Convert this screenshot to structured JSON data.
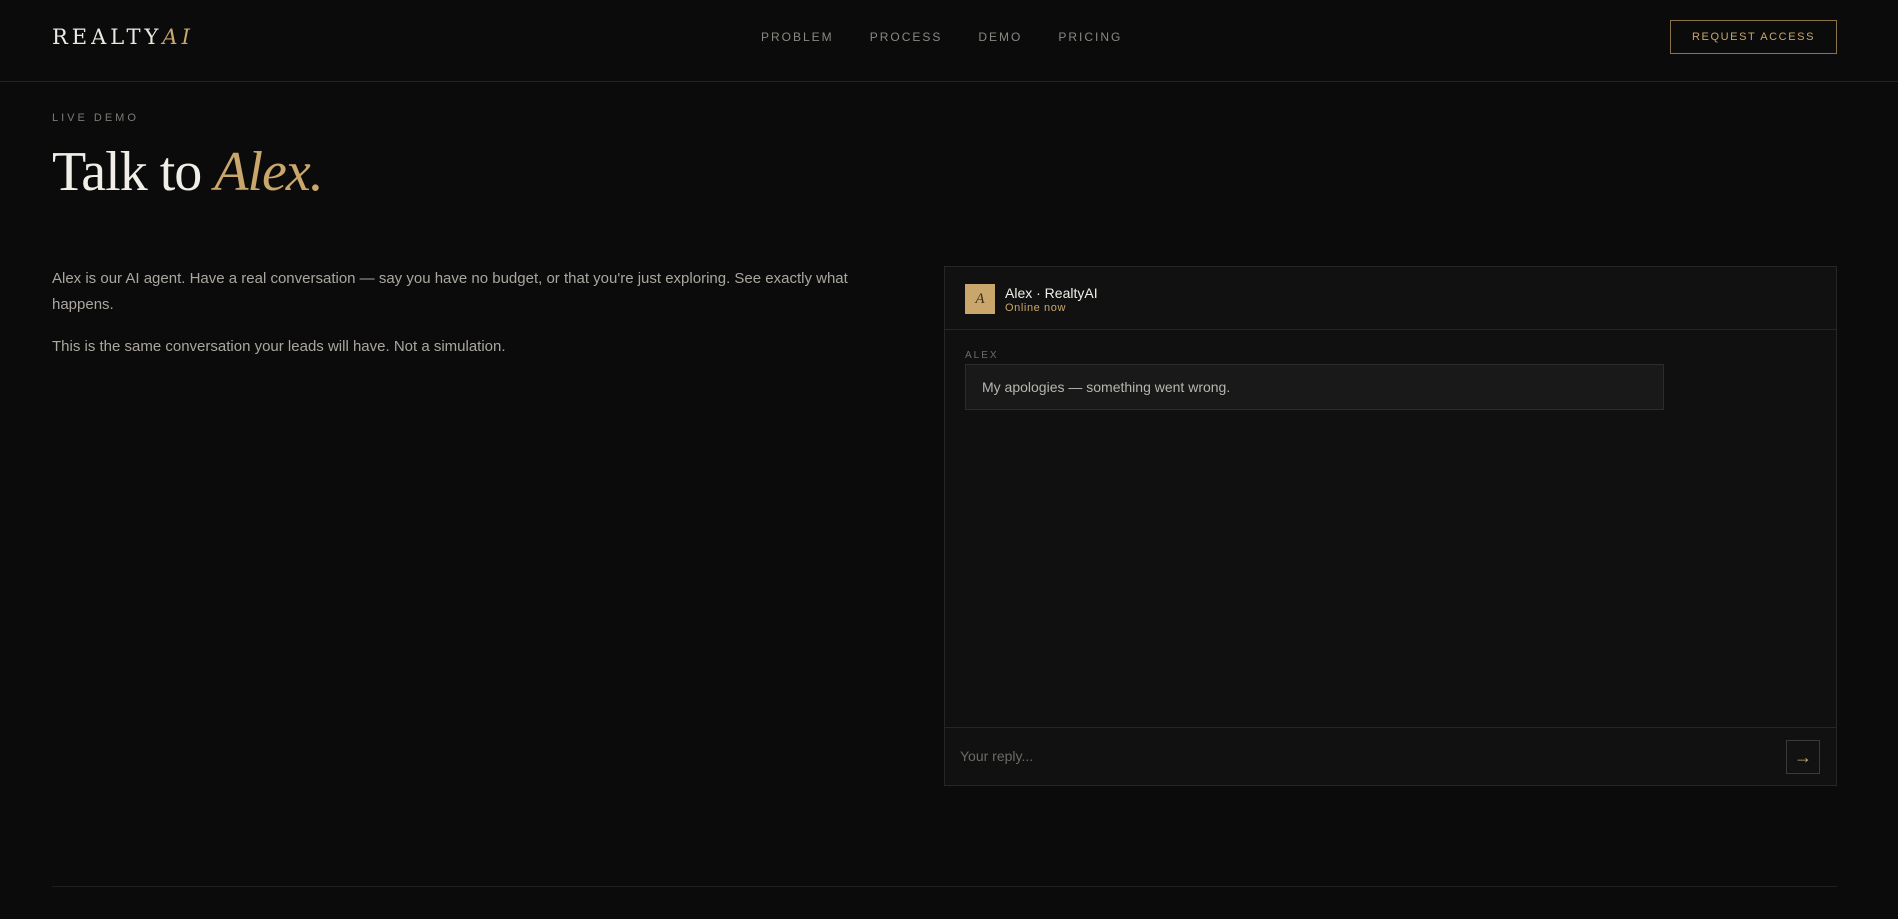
{
  "header": {
    "logo_main": "REALTY",
    "logo_accent": "AI",
    "nav": [
      {
        "label": "PROBLEM"
      },
      {
        "label": "PROCESS"
      },
      {
        "label": "DEMO"
      },
      {
        "label": "PRICING"
      }
    ],
    "cta_label": "REQUEST ACCESS"
  },
  "hero": {
    "eyebrow": "LIVE DEMO",
    "title_main": "Talk to",
    "title_accent": "Alex."
  },
  "intro": {
    "paragraph_1": "Alex is our AI agent. Have a real conversation — say you have no budget, or that you're just exploring. See exactly what happens.",
    "paragraph_2": "This is the same conversation your leads will have. Not a simulation."
  },
  "chat": {
    "avatar_letter": "A",
    "agent_name": "Alex · RealtyAI",
    "status": "Online now",
    "messages": [
      {
        "sender": "ALEX",
        "text": "My apologies — something went wrong."
      }
    ],
    "composer": {
      "placeholder": "Your reply...",
      "value": "",
      "send_icon": "arrow-right-icon",
      "send_glyph": "→"
    }
  },
  "colors": {
    "background": "#0b0b0b",
    "accent": "#c9a66b",
    "text": "#f1eee7",
    "muted": "#aaa7a0"
  }
}
